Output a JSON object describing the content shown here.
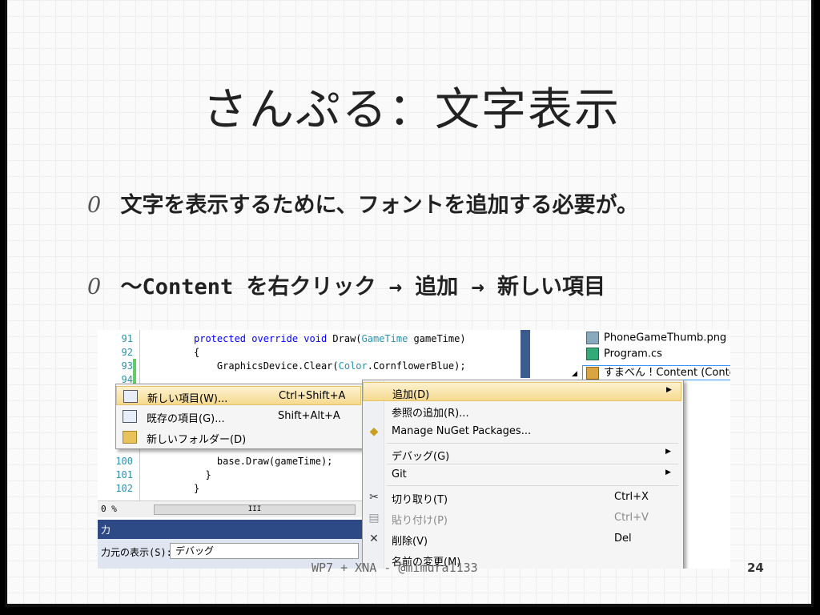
{
  "slide": {
    "title": "さんぷる：文字表示",
    "bullets": [
      {
        "mark": "0",
        "text": "文字を表示するために、フォントを追加する必要が。"
      },
      {
        "mark": "0",
        "text": "～Content を右クリック → 追加 → 新しい項目"
      }
    ],
    "footer": "WP7 + XNA - @mimura1133",
    "page_number": "24"
  },
  "editor": {
    "lines": [
      {
        "n": "91",
        "code": "protected override void Draw(GameTime gameTime)"
      },
      {
        "n": "92",
        "code": "{"
      },
      {
        "n": "93",
        "code": "    GraphicsDevice.Clear(Color.CornflowerBlue);"
      },
      {
        "n": "94",
        "code": ""
      },
      {
        "n": "100",
        "code": "    base.Draw(gameTime);"
      },
      {
        "n": "101",
        "code": "}"
      },
      {
        "n": "102",
        "code": "}"
      }
    ],
    "zoom": "0 %",
    "scroll_thumb": "III",
    "output_title": "力",
    "output_source_label": "力元の表示(S):",
    "output_source_value": "デバッグ"
  },
  "solution": {
    "items": [
      {
        "label": "PhoneGameThumb.png",
        "icon": "image-icon"
      },
      {
        "label": "Program.cs",
        "icon": "csharp-file-icon"
      },
      {
        "label": "すまべん ! Content (Content)",
        "icon": "content-project-icon",
        "selected": true
      }
    ]
  },
  "context_menu": {
    "items": [
      {
        "label": "追加(D)",
        "shortcut": "",
        "submenu": true,
        "highlighted": true,
        "icon": ""
      },
      {
        "label": "参照の追加(R)...",
        "shortcut": "",
        "submenu": false,
        "icon": ""
      },
      {
        "label": "Manage NuGet Packages...",
        "shortcut": "",
        "submenu": false,
        "icon": "nuget-icon"
      },
      {
        "label": "デバッグ(G)",
        "shortcut": "",
        "submenu": true,
        "icon": ""
      },
      {
        "label": "Git",
        "shortcut": "",
        "submenu": true,
        "icon": ""
      },
      {
        "label": "切り取り(T)",
        "shortcut": "Ctrl+X",
        "submenu": false,
        "icon": "scissors-icon"
      },
      {
        "label": "貼り付け(P)",
        "shortcut": "Ctrl+V",
        "submenu": false,
        "icon": "paste-icon",
        "disabled": true
      },
      {
        "label": "削除(V)",
        "shortcut": "Del",
        "submenu": false,
        "icon": "delete-icon"
      },
      {
        "label": "名前の変更(M)",
        "shortcut": "",
        "submenu": false,
        "icon": ""
      }
    ]
  },
  "submenu": {
    "items": [
      {
        "label": "新しい項目(W)...",
        "shortcut": "Ctrl+Shift+A",
        "highlighted": true
      },
      {
        "label": "既存の項目(G)...",
        "shortcut": "Shift+Alt+A"
      },
      {
        "label": "新しいフォルダー(D)",
        "shortcut": ""
      }
    ]
  },
  "colors": {
    "accent": "#2e4a86",
    "highlight": "#f6d98e",
    "keyword": "#0000ff",
    "type": "#2b91af"
  }
}
